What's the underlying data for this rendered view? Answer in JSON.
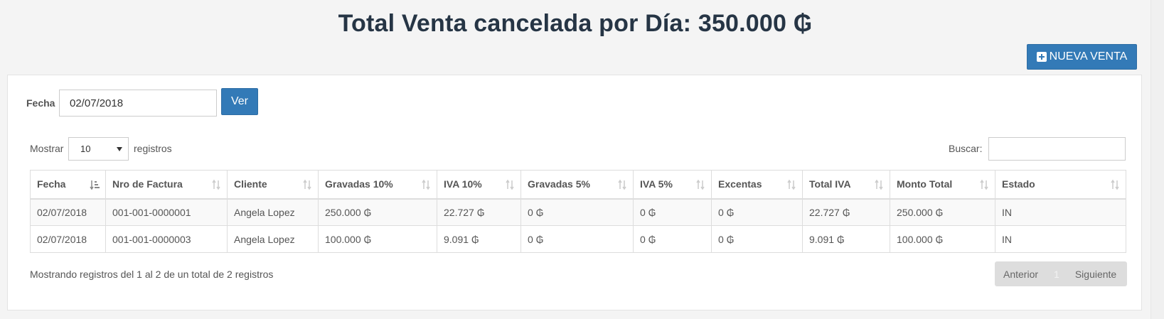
{
  "header": {
    "title": "Total Venta cancelada por Día: 350.000 ₲",
    "new_button_label": "NUEVA VENTA"
  },
  "filter": {
    "fecha_label": "Fecha",
    "fecha_value": "02/07/2018",
    "ver_label": "Ver"
  },
  "table_controls": {
    "mostrar_label": "Mostrar",
    "page_size": "10",
    "registros_label": "registros",
    "buscar_label": "Buscar:",
    "buscar_value": ""
  },
  "table": {
    "columns": [
      "Fecha",
      "Nro de Factura",
      "Cliente",
      "Gravadas 10%",
      "IVA 10%",
      "Gravadas 5%",
      "IVA 5%",
      "Excentas",
      "Total IVA",
      "Monto Total",
      "Estado"
    ],
    "rows": [
      [
        "02/07/2018",
        "001-001-0000001",
        "Angela Lopez",
        "250.000 ₲",
        "22.727 ₲",
        "0 ₲",
        "0 ₲",
        "0 ₲",
        "22.727 ₲",
        "250.000 ₲",
        "IN"
      ],
      [
        "02/07/2018",
        "001-001-0000003",
        "Angela Lopez",
        "100.000 ₲",
        "9.091 ₲",
        "0 ₲",
        "0 ₲",
        "0 ₲",
        "9.091 ₲",
        "100.000 ₲",
        "IN"
      ]
    ]
  },
  "footer": {
    "info": "Mostrando registros del 1 al 2 de un total de 2 registros",
    "prev_label": "Anterior",
    "page": "1",
    "next_label": "Siguiente"
  },
  "colors": {
    "primary": "#337ab7",
    "title": "#263545"
  }
}
